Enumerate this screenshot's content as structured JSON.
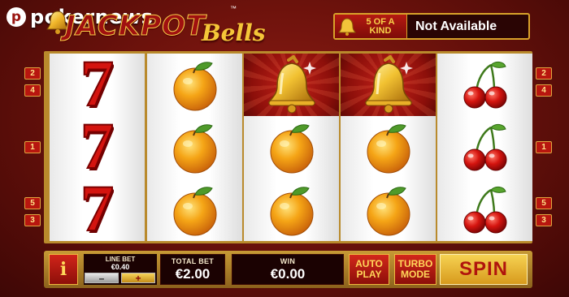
{
  "brand": {
    "mark": "p",
    "name": "pokernews"
  },
  "game": {
    "title_main": "JACKPOT",
    "title_script": "Bells",
    "trademark": "™"
  },
  "five_of_a_kind": {
    "badge_line1": "5 OF A",
    "badge_line2": "KIND",
    "status": "Not Available"
  },
  "paylines": {
    "left": [
      "2",
      "4",
      "1",
      "5",
      "3"
    ],
    "right": [
      "2",
      "4",
      "1",
      "5",
      "3"
    ]
  },
  "reels": [
    [
      "seven",
      "seven",
      "seven"
    ],
    [
      "orange",
      "orange",
      "orange"
    ],
    [
      "bell",
      "orange",
      "orange"
    ],
    [
      "bell",
      "orange",
      "orange"
    ],
    [
      "cherry",
      "cherry",
      "cherry"
    ]
  ],
  "highlighted_cells": [
    [
      2,
      0
    ],
    [
      3,
      0
    ]
  ],
  "controls": {
    "info_label": "i",
    "line_bet_label": "LINE BET",
    "line_bet_value": "€0.40",
    "minus_label": "–",
    "plus_label": "+",
    "total_bet_label": "TOTAL BET",
    "total_bet_value": "€2.00",
    "win_label": "WIN",
    "win_value": "€0.00",
    "auto_play_line1": "AUTO",
    "auto_play_line2": "PLAY",
    "turbo_line1": "TURBO",
    "turbo_line2": "MODE",
    "spin_label": "SPIN"
  },
  "colors": {
    "accent_red": "#b8160f",
    "gold": "#d8a22a",
    "panel_dark": "#1b0202"
  }
}
